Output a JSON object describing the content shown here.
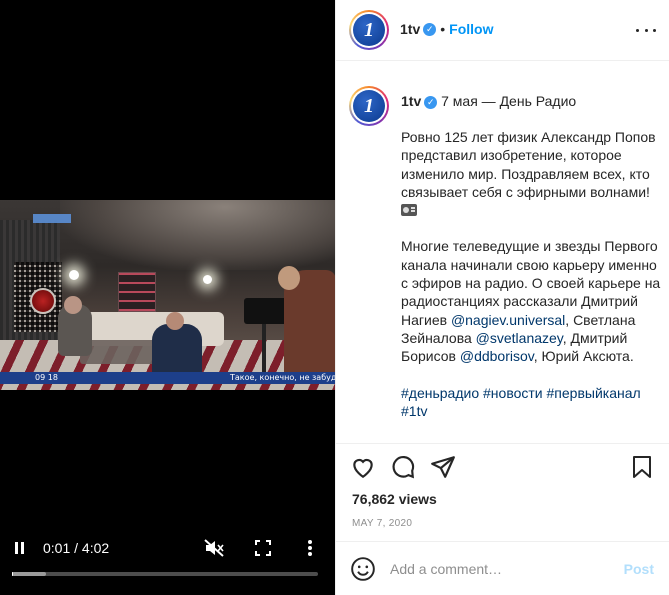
{
  "video": {
    "time": "0:01 / 4:02",
    "progress_fraction": 0.004,
    "buffered_fraction": 0.11,
    "overlay_clock": "09 18",
    "ticker_text": "Такое, конечно, не забуд",
    "icons": [
      "pause-icon",
      "mute-icon",
      "fullscreen-icon",
      "more-vertical-icon"
    ]
  },
  "header": {
    "username": "1tv",
    "verified_glyph": "✓",
    "separator": "•",
    "follow_label": "Follow",
    "avatar_letter": "1"
  },
  "caption": {
    "username": "1tv",
    "intro": "7 мая — День Радио",
    "para1": "Ровно 125 лет физик Александр Попов представил изобретение, которое изменило мир. Поздравляем всех, кто связывает себя с эфирными волнами!",
    "para2_a": "Многие телеведущие и звезды Первого канала начинали свою карьеру именно с эфиров на радио. О своей карьере на радиостанциях рассказали Дмитрий Нагиев",
    "mention1": "@nagiev.universal",
    "para2_b": ", Светлана Зейналова",
    "mention2": "@svetlanazey",
    "para2_c": ", Дмитрий Борисов",
    "mention3": "@ddborisov",
    "para2_d": ", Юрий Аксюта.",
    "hashtags": [
      "#деньрадио",
      "#новости",
      "#первыйканал",
      "#1tv"
    ]
  },
  "stats": {
    "views": "76,862 views",
    "date": "MAY 7, 2020"
  },
  "comment": {
    "placeholder": "Add a comment…",
    "post_label": "Post"
  },
  "colors": {
    "link": "#0095f6",
    "mention": "#00376b",
    "ticker": "#1d3f8a",
    "post_disabled": "#b2dffc"
  }
}
